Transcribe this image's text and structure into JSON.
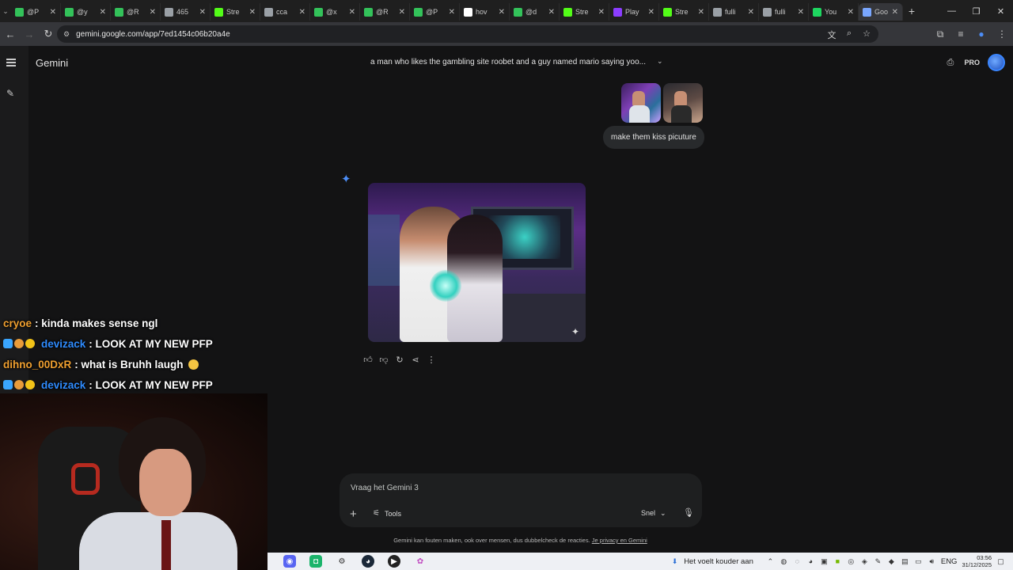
{
  "browser": {
    "tabs": [
      {
        "label": "@P",
        "icon": "green-app-icon",
        "color": "#33c25a"
      },
      {
        "label": "@y",
        "icon": "green-app-icon",
        "color": "#33c25a"
      },
      {
        "label": "@R",
        "icon": "green-app-icon",
        "color": "#33c25a"
      },
      {
        "label": "465",
        "icon": "globe-icon",
        "color": "#9aa0a6"
      },
      {
        "label": "Stre",
        "icon": "kick-icon",
        "color": "#53fc18"
      },
      {
        "label": "cca",
        "icon": "globe-icon",
        "color": "#9aa0a6"
      },
      {
        "label": "@x",
        "icon": "green-app-icon",
        "color": "#33c25a"
      },
      {
        "label": "@R",
        "icon": "green-app-icon",
        "color": "#33c25a"
      },
      {
        "label": "@P",
        "icon": "green-app-icon",
        "color": "#33c25a"
      },
      {
        "label": "hov",
        "icon": "google-icon",
        "color": "#ffffff"
      },
      {
        "label": "@d",
        "icon": "green-app-icon",
        "color": "#33c25a"
      },
      {
        "label": "Stre",
        "icon": "kick-icon",
        "color": "#53fc18"
      },
      {
        "label": "Play",
        "icon": "stake-icon",
        "color": "#8b3dff"
      },
      {
        "label": "Stre",
        "icon": "kick-icon",
        "color": "#53fc18"
      },
      {
        "label": "fulli",
        "icon": "globe-icon",
        "color": "#9aa0a6"
      },
      {
        "label": "fulli",
        "icon": "globe-icon",
        "color": "#9aa0a6"
      },
      {
        "label": "You",
        "icon": "spotify-icon",
        "color": "#1ed760"
      },
      {
        "label": "Goo",
        "icon": "gemini-icon",
        "color": "#7aa7ff",
        "active": true
      }
    ],
    "url": "gemini.google.com/app/7ed1454c06b20a4e"
  },
  "app": {
    "brand": "Gemini",
    "conversation_title": "a man who likes the gambling site roobet and a guy named mario saying yoo...",
    "pro_label": "PRO",
    "user_message": "make them kiss picuture",
    "composer_placeholder": "Vraag het Gemini 3",
    "tools_label": "Tools",
    "mode_label": "Snel",
    "disclaimer": "Gemini kan fouten maken, ook over mensen, dus dubbelcheck de reacties.",
    "privacy_link": "Je privacy en Gemini"
  },
  "chat": [
    {
      "user": "cryoe",
      "user_color": "#f0a030",
      "badges": [],
      "message": ": kinda makes sense ngl"
    },
    {
      "user": "devizack",
      "user_color": "#2f8cff",
      "badges": [
        "b1",
        "b2",
        "b3"
      ],
      "message": ": LOOK AT MY NEW PFP"
    },
    {
      "user": "dihno_00DxR",
      "user_color": "#f0a030",
      "badges": [],
      "message": ": what is Bruhh laugh",
      "emoji": true
    },
    {
      "user": "devizack",
      "user_color": "#2f8cff",
      "badges": [
        "b1",
        "b2",
        "b3"
      ],
      "message": ": LOOK AT MY NEW PFP"
    }
  ],
  "taskbar": {
    "weather": "Het voelt kouder aan",
    "language": "ENG",
    "time": "03:56",
    "date": "31/12/2025"
  }
}
